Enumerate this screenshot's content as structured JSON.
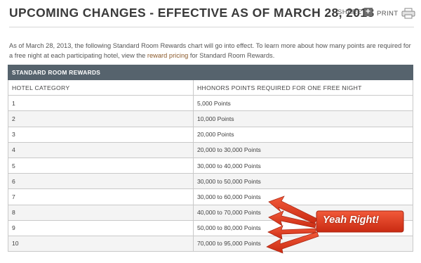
{
  "header": {
    "title": "UPCOMING CHANGES - EFFECTIVE AS OF MARCH 28, 2013",
    "share_label": "SHARE",
    "print_label": "PRINT"
  },
  "intro": {
    "before_link": "As of March 28, 2013, the following  Standard Room Rewards chart will go into effect. To learn more about how many points are required for a free night at each participating hotel, view the ",
    "link": "reward pricing",
    "after_link": " for Standard Room Rewards."
  },
  "table": {
    "caption": "STANDARD ROOM REWARDS",
    "columns": [
      "HOTEL CATEGORY",
      "HHONORS POINTS REQUIRED FOR ONE FREE NIGHT"
    ],
    "rows": [
      [
        "1",
        "5,000 Points"
      ],
      [
        "2",
        "10,000 Points"
      ],
      [
        "3",
        "20,000 Points"
      ],
      [
        "4",
        "20,000 to 30,000 Points"
      ],
      [
        "5",
        "30,000 to 40,000 Points"
      ],
      [
        "6",
        "30,000 to 50,000 Points"
      ],
      [
        "7",
        "30,000 to 60,000 Points"
      ],
      [
        "8",
        "40,000 to 70,000 Points"
      ],
      [
        "9",
        "50,000 to 80,000 Points"
      ],
      [
        "10",
        "70,000 to 95,000 Points"
      ]
    ]
  },
  "annotation": {
    "text": "Yeah Right!"
  },
  "colors": {
    "title": "#3a3a3a",
    "table_header_bg": "#56636d",
    "link": "#8c5a2b",
    "annotation_red": "#e8391d"
  },
  "icons": [
    "plus-icon",
    "printer-icon",
    "arrow-icon"
  ]
}
